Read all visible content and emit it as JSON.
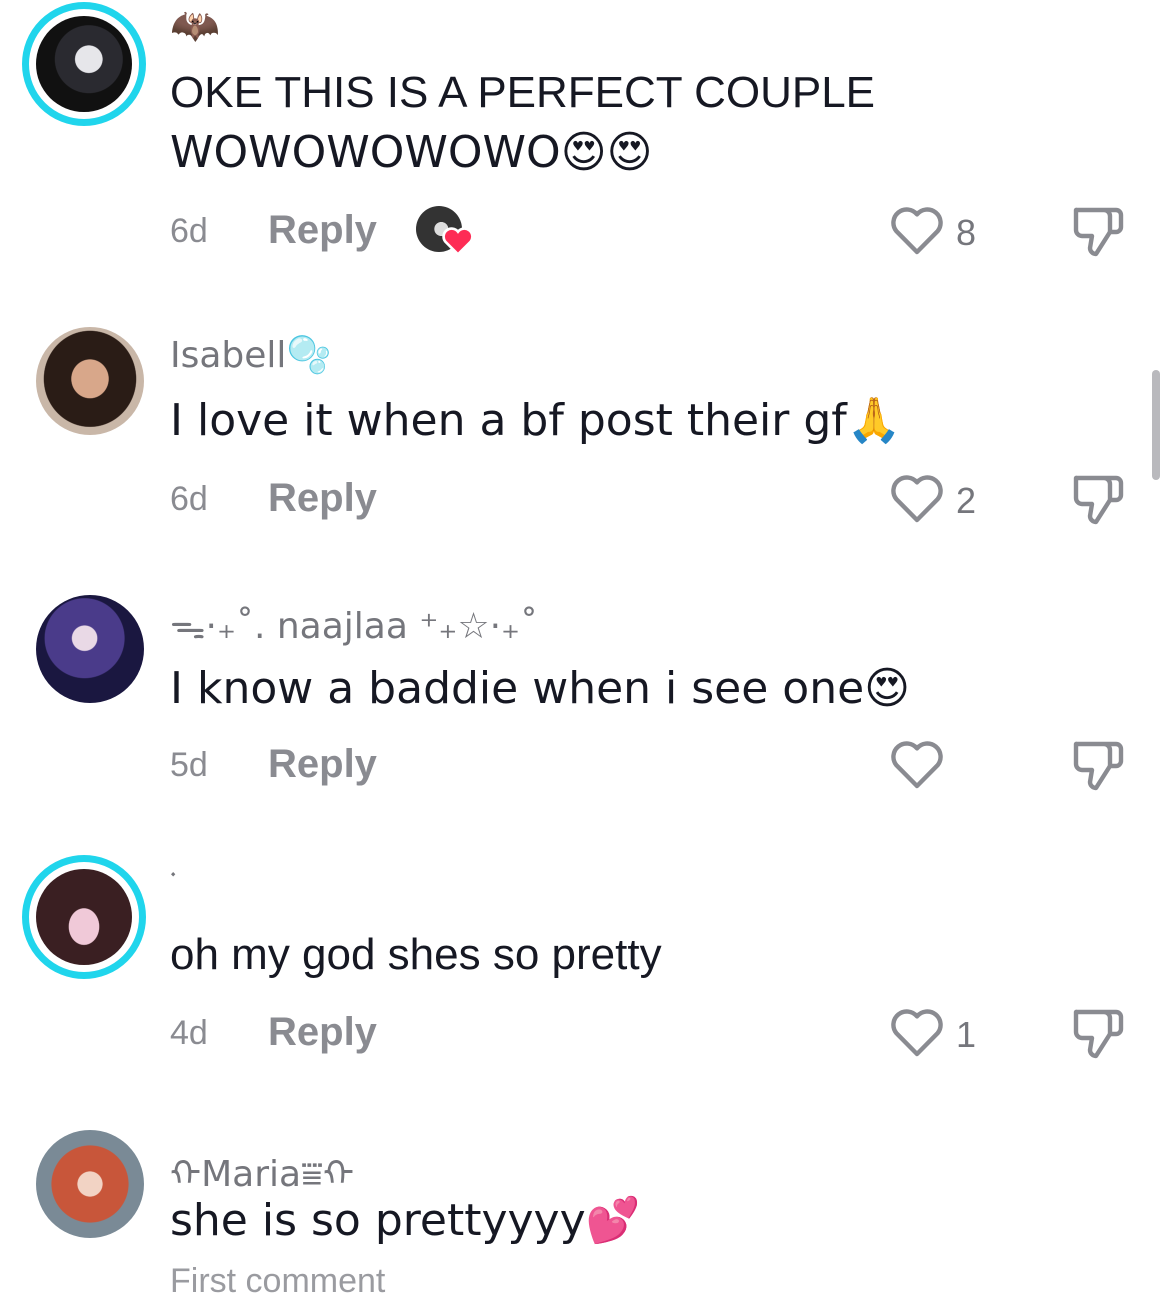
{
  "comments": [
    {
      "username": "🦇",
      "text_line1": "OKE THIS IS A PERFECT COUPLE",
      "text_line2": "WOWOWOWOWO😍😍",
      "age": "6d",
      "reply_label": "Reply",
      "likes": "8",
      "creator_liked": true,
      "story_ring": true
    },
    {
      "username": "Isabell🫧",
      "text": "I love it when a bf post their gf🙏",
      "age": "6d",
      "reply_label": "Reply",
      "likes": "2",
      "story_ring": false
    },
    {
      "username": "ᯓ·₊˚. naajlaa ⁺₊☆·₊˚",
      "text": "I know a baddie when i see one😍",
      "age": "5d",
      "reply_label": "Reply",
      "likes": "",
      "story_ring": false
    },
    {
      "username": "𝆺",
      "text": "oh my god shes so pretty",
      "age": "4d",
      "reply_label": "Reply",
      "likes": "1",
      "story_ring": true
    },
    {
      "username": "ᡣMaria⩸ᡣ",
      "text": "she is so prettyyyy💕",
      "footer": "First comment",
      "story_ring": false
    }
  ],
  "colors": {
    "story_ring": "#20d5ec",
    "meta_gray": "#8a8b91",
    "heart_red": "#fe2c55"
  },
  "icons": {
    "like": "heart-outline-icon",
    "dislike": "thumbs-down-icon",
    "creator_like": "creator-liked-heart-icon"
  }
}
